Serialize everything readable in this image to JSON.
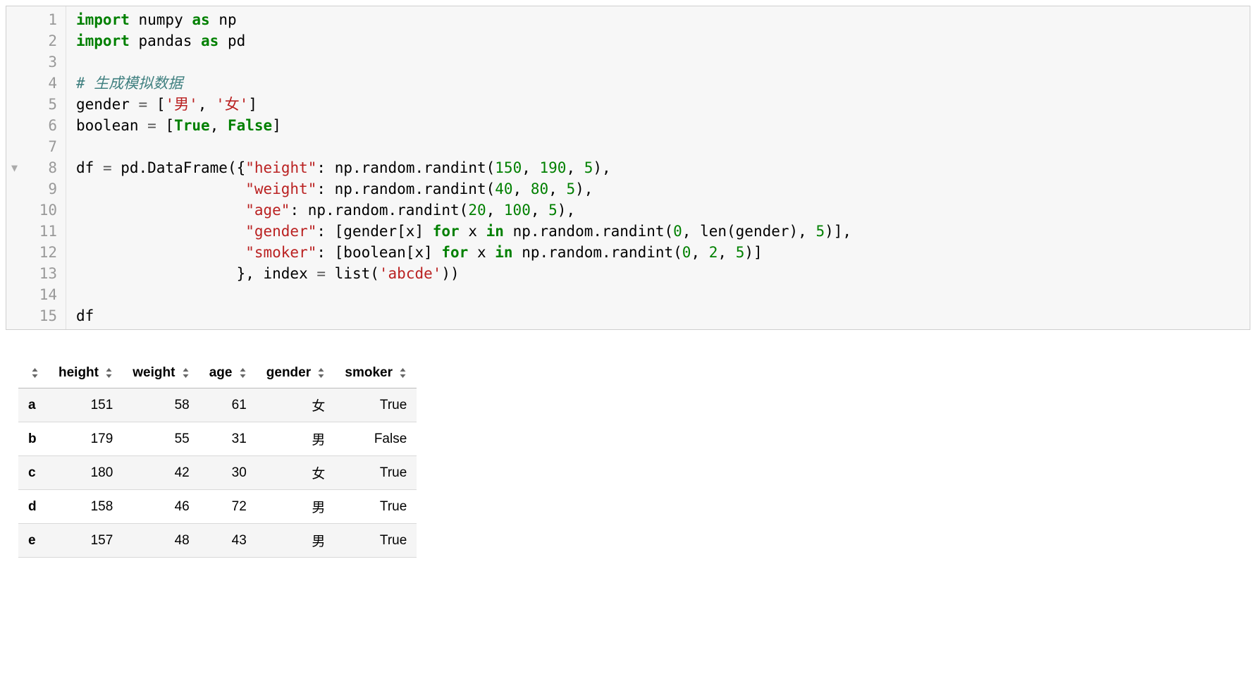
{
  "code": {
    "line_numbers": [
      "1",
      "2",
      "3",
      "4",
      "5",
      "6",
      "7",
      "8",
      "9",
      "10",
      "11",
      "12",
      "13",
      "14",
      "15"
    ],
    "fold_at_line": 8,
    "lines": {
      "l1": {
        "t1": "import",
        "t2": " numpy ",
        "t3": "as",
        "t4": " np"
      },
      "l2": {
        "t1": "import",
        "t2": " pandas ",
        "t3": "as",
        "t4": " pd"
      },
      "l4": {
        "t1": "# 生成模拟数据"
      },
      "l5": {
        "t1": "gender ",
        "t2": "=",
        "t3": " [",
        "t4": "'男'",
        "t5": ", ",
        "t6": "'女'",
        "t7": "]"
      },
      "l6": {
        "t1": "boolean ",
        "t2": "=",
        "t3": " [",
        "t4": "True",
        "t5": ", ",
        "t6": "False",
        "t7": "]"
      },
      "l8": {
        "t1": "df ",
        "t2": "=",
        "t3": " pd.DataFrame({",
        "t4": "\"height\"",
        "t5": ": np.random.randint(",
        "t6": "150",
        "t7": ", ",
        "t8": "190",
        "t9": ", ",
        "t10": "5",
        "t11": "),"
      },
      "l9": {
        "pad": "                   ",
        "t4": "\"weight\"",
        "t5": ": np.random.randint(",
        "t6": "40",
        "t7": ", ",
        "t8": "80",
        "t9": ", ",
        "t10": "5",
        "t11": "),"
      },
      "l10": {
        "pad": "                   ",
        "t4": "\"age\"",
        "t5": ": np.random.randint(",
        "t6": "20",
        "t7": ", ",
        "t8": "100",
        "t9": ", ",
        "t10": "5",
        "t11": "),"
      },
      "l11": {
        "pad": "                   ",
        "t4": "\"gender\"",
        "t5": ": [gender[x] ",
        "t6": "for",
        "t7": " x ",
        "t8": "in",
        "t9": " np.random.randint(",
        "t10": "0",
        "t11": ", len(gender), ",
        "t12": "5",
        "t13": ")],"
      },
      "l12": {
        "pad": "                   ",
        "t4": "\"smoker\"",
        "t5": ": [boolean[x] ",
        "t6": "for",
        "t7": " x ",
        "t8": "in",
        "t9": " np.random.randint(",
        "t10": "0",
        "t11": ", ",
        "t12": "2",
        "t13": ", ",
        "t14": "5",
        "t15": ")]"
      },
      "l13": {
        "pad": "                  ",
        "t1": "}, index ",
        "t2": "=",
        "t3": " list(",
        "t4": "'abcde'",
        "t5": "))"
      },
      "l15": {
        "t1": "df"
      }
    }
  },
  "dataframe": {
    "columns": [
      "height",
      "weight",
      "age",
      "gender",
      "smoker"
    ],
    "index": [
      "a",
      "b",
      "c",
      "d",
      "e"
    ],
    "rows": [
      {
        "height": "151",
        "weight": "58",
        "age": "61",
        "gender": "女",
        "smoker": "True"
      },
      {
        "height": "179",
        "weight": "55",
        "age": "31",
        "gender": "男",
        "smoker": "False"
      },
      {
        "height": "180",
        "weight": "42",
        "age": "30",
        "gender": "女",
        "smoker": "True"
      },
      {
        "height": "158",
        "weight": "46",
        "age": "72",
        "gender": "男",
        "smoker": "True"
      },
      {
        "height": "157",
        "weight": "48",
        "age": "43",
        "gender": "男",
        "smoker": "True"
      }
    ]
  }
}
